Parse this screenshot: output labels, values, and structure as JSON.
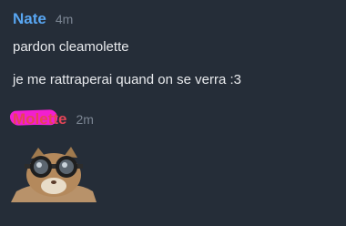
{
  "messages": [
    {
      "author": "Nate",
      "time": "4m",
      "author_color": "#58a6f2",
      "lines": [
        "pardon cleamolette",
        "je me rattraperai quand on se verra :3"
      ]
    },
    {
      "author": "Molette",
      "time": "2m",
      "author_color": "#e54558",
      "attachment": {
        "type": "sticker",
        "icon": "cat-with-goggles-icon"
      }
    }
  ],
  "colors": {
    "background": "#252d38",
    "text": "#e8eaed",
    "timestamp": "#7b8592",
    "redaction": "#f21fd0"
  }
}
